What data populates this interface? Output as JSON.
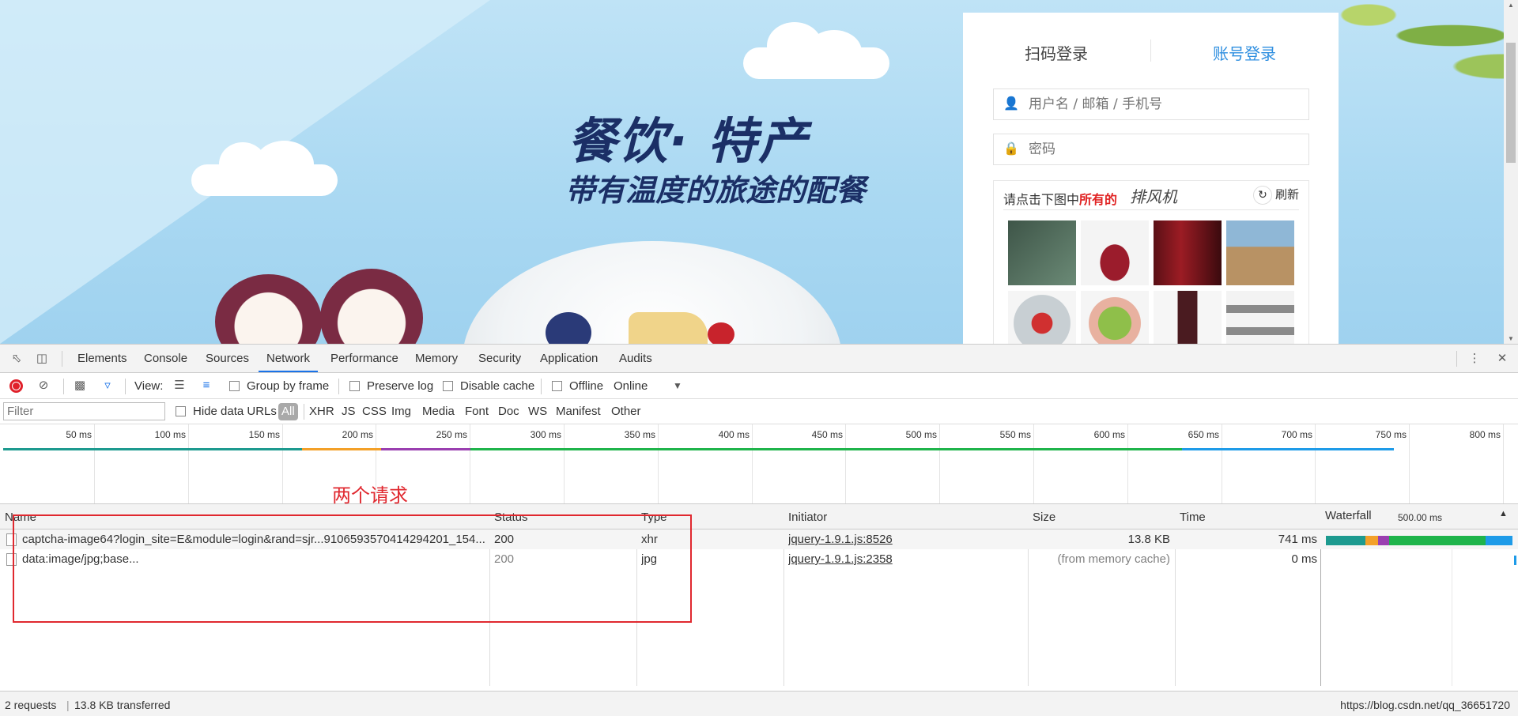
{
  "page": {
    "headline": "餐饮· 特产",
    "subline": "带有温度的旅途的配餐",
    "login": {
      "tab_qr": "扫码登录",
      "tab_account": "账号登录",
      "user_placeholder": "用户名 / 邮箱 / 手机号",
      "password_placeholder": "密码",
      "captcha_hint_prefix": "请点击下图中",
      "captcha_hint_emph": "所有的",
      "captcha_word": "排风机",
      "refresh_label": "刷新"
    }
  },
  "devtools": {
    "tabs": [
      "Elements",
      "Console",
      "Sources",
      "Network",
      "Performance",
      "Memory",
      "Security",
      "Application",
      "Audits"
    ],
    "active_tab": "Network",
    "toolbar": {
      "view_label": "View:",
      "group_by_frame": "Group by frame",
      "preserve_log": "Preserve log",
      "disable_cache": "Disable cache",
      "offline": "Offline",
      "throttle": "Online"
    },
    "filterbar": {
      "filter_placeholder": "Filter",
      "hide_data_urls": "Hide data URLs",
      "all": "All",
      "types": [
        "XHR",
        "JS",
        "CSS",
        "Img",
        "Media",
        "Font",
        "Doc",
        "WS",
        "Manifest",
        "Other"
      ]
    },
    "timeline_ticks": [
      "50 ms",
      "100 ms",
      "150 ms",
      "200 ms",
      "250 ms",
      "300 ms",
      "350 ms",
      "400 ms",
      "450 ms",
      "500 ms",
      "550 ms",
      "600 ms",
      "650 ms",
      "700 ms",
      "750 ms",
      "800 ms"
    ],
    "columns": {
      "name": "Name",
      "status": "Status",
      "type": "Type",
      "initiator": "Initiator",
      "size": "Size",
      "time": "Time",
      "waterfall": "Waterfall",
      "waterfall_scale": "500.00 ms"
    },
    "requests": [
      {
        "name": "captcha-image64?login_site=E&module=login&rand=sjr...9106593570414294201_154...",
        "status": "200",
        "type": "xhr",
        "initiator": "jquery-1.9.1.js:8526",
        "size": "13.8 KB",
        "time": "741 ms"
      },
      {
        "name": "data:image/jpg;base...",
        "status": "200",
        "type": "jpg",
        "initiator": "jquery-1.9.1.js:2358",
        "size": "(from memory cache)",
        "time": "0 ms"
      }
    ],
    "status": {
      "requests": "2 requests",
      "transferred": "13.8 KB transferred",
      "watermark": "https://blog.csdn.net/qq_36651720"
    },
    "annotation": "两个请求"
  },
  "colors": {
    "accent_blue": "#1a73e8",
    "record_red": "#e0202a",
    "annotation_red": "#e0282f",
    "headline_navy": "#1b2f66"
  }
}
